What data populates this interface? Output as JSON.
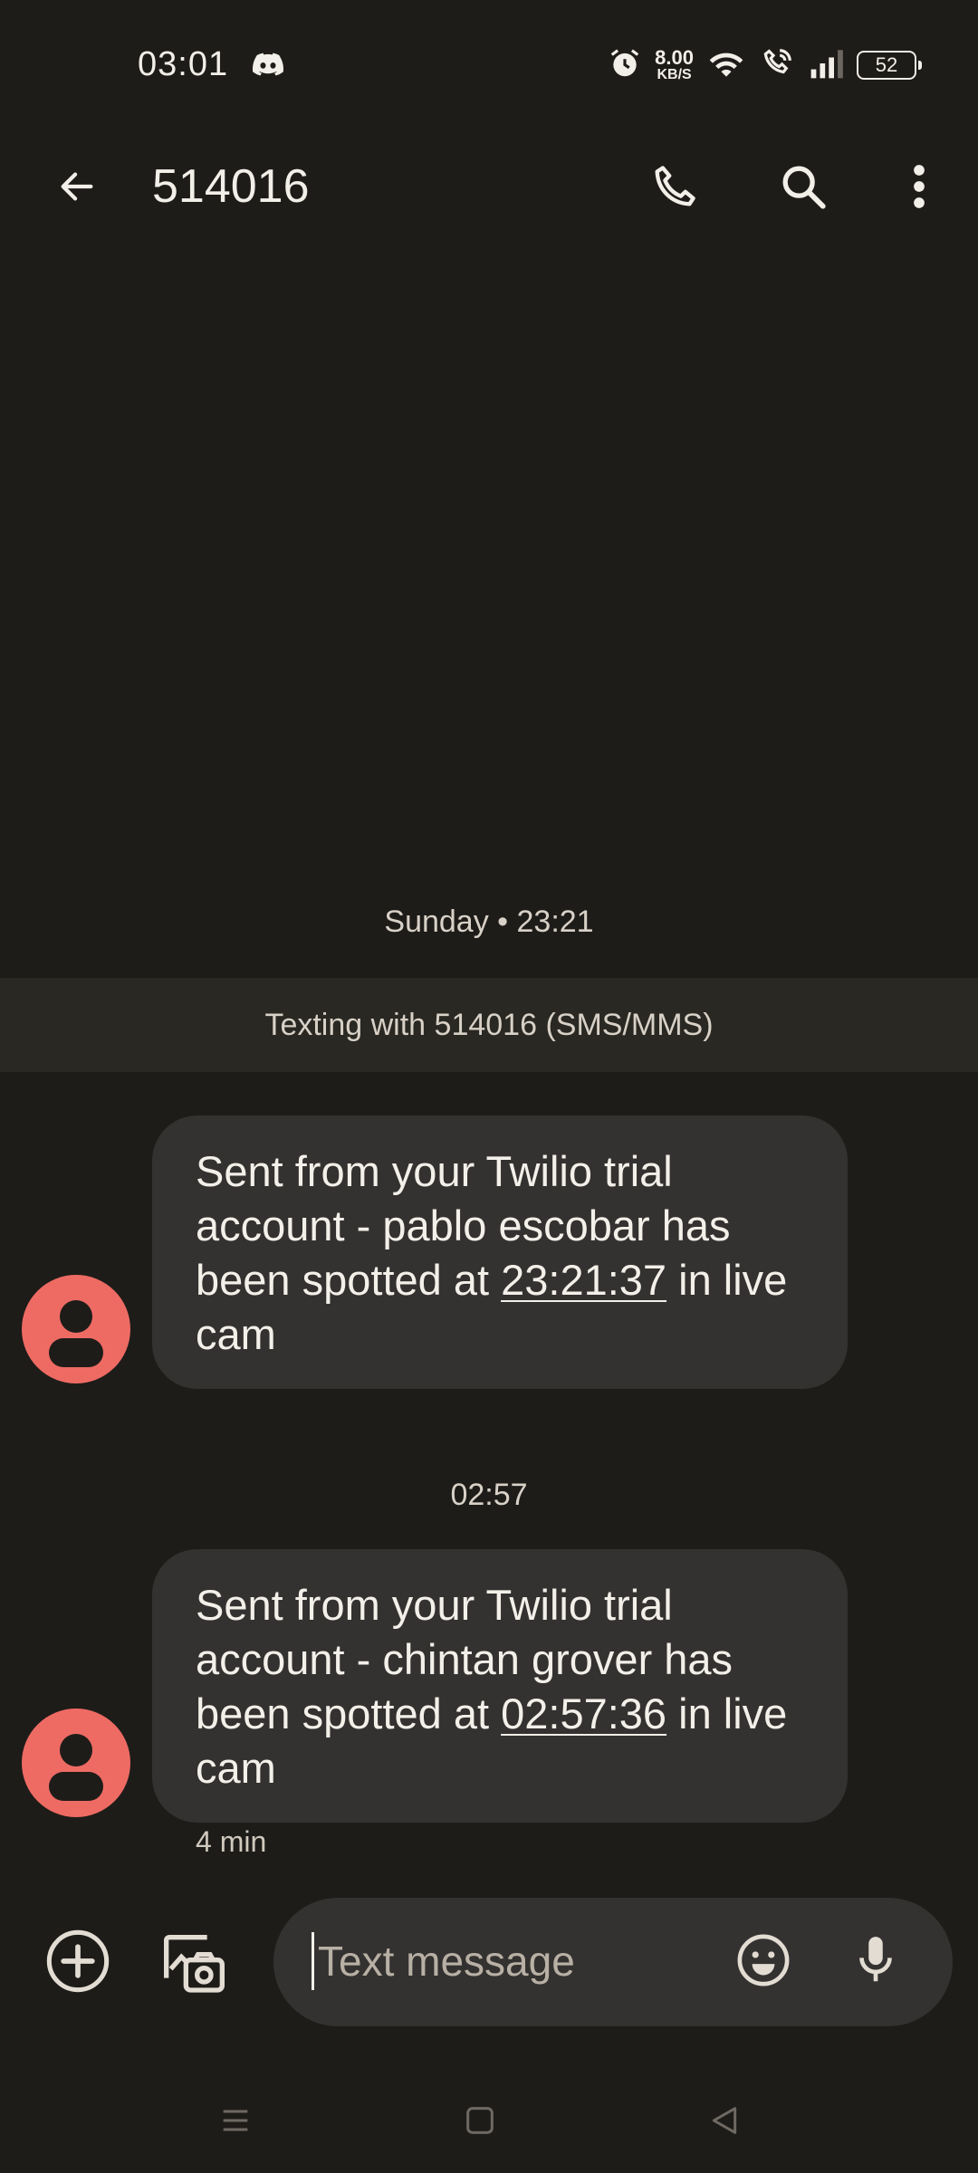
{
  "status_bar": {
    "time": "03:01",
    "notification_icon": "discord-icon",
    "net_speed_value": "8.00",
    "net_speed_unit": "KB/S",
    "battery": "52",
    "icons": [
      "alarm-icon",
      "wifi-icon",
      "wifi-call-icon",
      "signal-icon",
      "battery-icon"
    ]
  },
  "header": {
    "title": "514016",
    "icons": [
      "back-arrow-icon",
      "phone-icon",
      "search-icon",
      "more-vert-icon"
    ]
  },
  "conversation": {
    "banner": "Texting with 514016 (SMS/MMS)",
    "groups": [
      {
        "timestamp": "Sunday • 23:21",
        "message": {
          "text_before": "Sent from your Twilio trial account - pablo escobar has been spotted at ",
          "link": "23:21:37",
          "text_after": " in live cam"
        }
      },
      {
        "timestamp": "02:57",
        "message": {
          "text_before": "Sent from your Twilio trial account - chintan grover has been spotted at ",
          "link": "02:57:36",
          "text_after": " in live cam"
        },
        "meta": "4 min"
      }
    ]
  },
  "compose": {
    "placeholder": "Text message",
    "icons": [
      "add-circle-icon",
      "gallery-camera-icon",
      "emoji-icon",
      "mic-icon"
    ]
  },
  "nav_bar": {
    "icons": [
      "menu-icon",
      "home-square-icon",
      "back-triangle-icon"
    ]
  },
  "colors": {
    "background": "#1e1c19",
    "bubble": "#343230",
    "avatar": "#ee6b64",
    "banner": "#2a2822",
    "text": "#f3efe9"
  }
}
